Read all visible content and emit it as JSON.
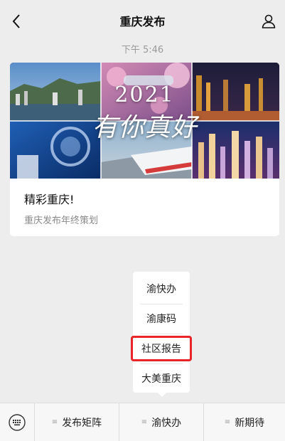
{
  "header": {
    "title": "重庆发布",
    "back_icon": "back-chevron-icon",
    "profile_icon": "profile-icon"
  },
  "message": {
    "timestamp": "下午 5:46"
  },
  "card": {
    "banner_year": "2021",
    "banner_slogan": "有你真好",
    "title": "精彩重庆!",
    "subtitle": "重庆发布年终策划"
  },
  "submenu": {
    "items": [
      {
        "label": "渝快办"
      },
      {
        "label": "渝康码"
      },
      {
        "label": "社区报告"
      },
      {
        "label": "大美重庆"
      }
    ],
    "highlight_color": "#e8262a"
  },
  "bottom_bar": {
    "keyboard_icon": "keyboard-icon",
    "tabs": [
      {
        "label": "发布矩阵"
      },
      {
        "label": "渝快办"
      },
      {
        "label": "新期待"
      }
    ]
  }
}
